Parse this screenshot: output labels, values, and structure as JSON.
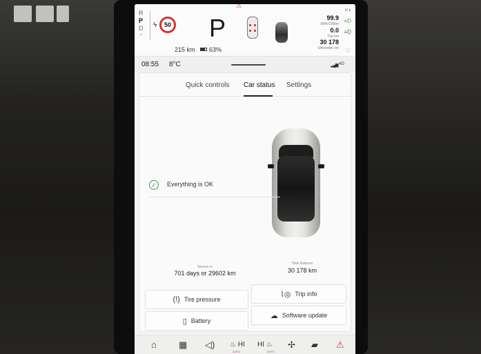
{
  "driver_info": {
    "gears": [
      "R",
      "P",
      "D"
    ],
    "selected_gear": "P",
    "speed_limit": "50",
    "range": "215 km",
    "battery_pct": "63%",
    "energy_value": "99.9",
    "energy_unit": "kWh/100km",
    "trip_value": "0.0",
    "trip_unit": "Trip km",
    "odometer_value": "30 178",
    "odometer_unit": "Odometer km"
  },
  "status_bar": {
    "time": "08:55",
    "temperature": "8°C",
    "network": "4G"
  },
  "tabs": [
    {
      "label": "Quick controls"
    },
    {
      "label": "Car status"
    },
    {
      "label": "Settings"
    }
  ],
  "car_status": {
    "ok_text": "Everything is OK",
    "service_label": "Service in",
    "service_value": "701 days or 29602 km",
    "distance_label": "Total distance",
    "distance_value": "30 178 km"
  },
  "buttons": {
    "tire_pressure": "Tire pressure",
    "trip_info": "Trip info",
    "battery": "Battery",
    "software_update": "Software update"
  },
  "bottom_nav": {
    "seat_left_label": "HI",
    "seat_right_label": "HI",
    "seat_left_sub": "AUTO",
    "seat_right_sub": "AUTO"
  },
  "colors": {
    "warning_red": "#d23232",
    "ok_green": "#4b9b4b"
  }
}
